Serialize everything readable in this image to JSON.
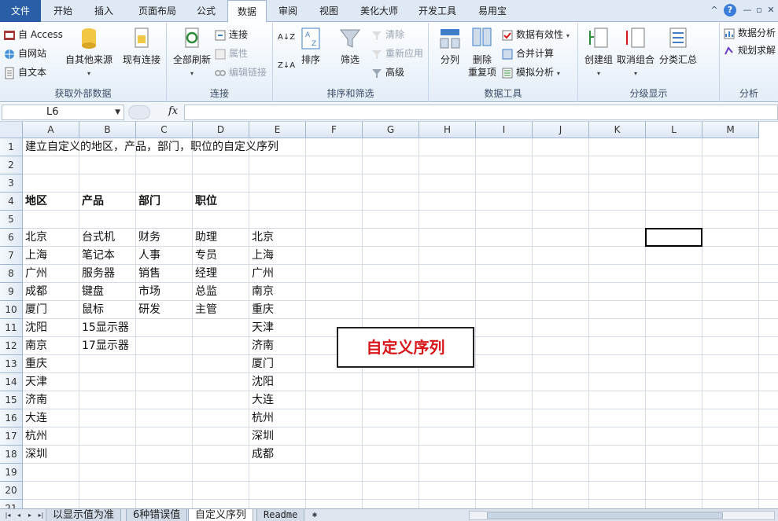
{
  "ribbon_tabs": [
    "文件",
    "开始",
    "插入",
    "页面布局",
    "公式",
    "数据",
    "审阅",
    "视图",
    "美化大师",
    "开发工具",
    "易用宝"
  ],
  "active_tab": "数据",
  "window_buttons": [
    "^",
    "?",
    "—",
    "▫",
    "✕"
  ],
  "ribbon": {
    "external": {
      "access": "自 Access",
      "web": "自网站",
      "text": "自文本",
      "other": "自其他来源",
      "existing": "现有连接",
      "label": "获取外部数据"
    },
    "connections": {
      "refresh": "全部刷新",
      "connections": "连接",
      "properties": "属性",
      "edit_links": "编辑链接",
      "label": "连接"
    },
    "sort_filter": {
      "sort_az": "A↓Z",
      "sort_za": "Z↓A",
      "sort": "排序",
      "filter": "筛选",
      "clear": "清除",
      "reapply": "重新应用",
      "advanced": "高级",
      "label": "排序和筛选"
    },
    "data_tools": {
      "split": "分列",
      "remove_dup_1": "删除",
      "remove_dup_2": "重复项",
      "validation": "数据有效性",
      "consolidate": "合并计算",
      "whatif": "模拟分析",
      "label": "数据工具"
    },
    "outline": {
      "group": "创建组",
      "ungroup": "取消组合",
      "subtotal": "分类汇总",
      "label": "分级显示"
    },
    "analysis": {
      "data_analysis": "数据分析",
      "solver": "规划求解",
      "label": "分析"
    }
  },
  "formula_bar": {
    "name_box": "L6",
    "fx": "fx",
    "formula": ""
  },
  "columns": [
    "A",
    "B",
    "C",
    "D",
    "E",
    "F",
    "G",
    "H",
    "I",
    "J",
    "K",
    "L",
    "M"
  ],
  "rows": [
    "1",
    "2",
    "3",
    "4",
    "5",
    "6",
    "7",
    "8",
    "9",
    "10",
    "11",
    "12",
    "13",
    "14",
    "15",
    "16",
    "17",
    "18",
    "19",
    "20",
    "21"
  ],
  "cells": {
    "A1": "建立自定义的地区，产品，部门，职位的自定义序列",
    "A4": "地区",
    "B4": "产品",
    "C4": "部门",
    "D4": "职位",
    "A6": "北京",
    "A7": "上海",
    "A8": "广州",
    "A9": "成都",
    "A10": "厦门",
    "A11": "沈阳",
    "A12": "南京",
    "A13": "重庆",
    "A14": "天津",
    "A15": "济南",
    "A16": "大连",
    "A17": "杭州",
    "A18": "深圳",
    "B6": "台式机",
    "B7": "笔记本",
    "B8": "服务器",
    "B9": "键盘",
    "B10": "鼠标",
    "B11": "15显示器",
    "B12": "17显示器",
    "C6": "财务",
    "C7": "人事",
    "C8": "销售",
    "C9": "市场",
    "C10": "研发",
    "D6": "助理",
    "D7": "专员",
    "D8": "经理",
    "D9": "总监",
    "D10": "主管",
    "E6": "北京",
    "E7": "上海",
    "E8": "广州",
    "E9": "南京",
    "E10": "重庆",
    "E11": "天津",
    "E12": "济南",
    "E13": "厦门",
    "E14": "沈阳",
    "E15": "大连",
    "E16": "杭州",
    "E17": "深圳",
    "E18": "成都"
  },
  "callout": "自定义序列",
  "sheet_tabs": [
    "以显示值为准",
    "6种错误值",
    "自定义序列",
    "Readme"
  ],
  "active_sheet": "自定义序列",
  "colors": {
    "file_tab": "#2a5fa8",
    "accent": "#d8161b",
    "header_bg": "#dde7f3"
  }
}
